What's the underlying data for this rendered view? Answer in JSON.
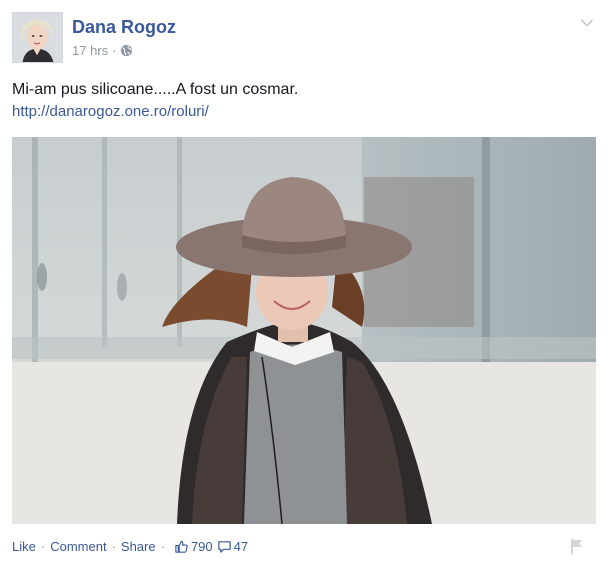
{
  "post": {
    "author_name": "Dana Rogoz",
    "timestamp": "17 hrs",
    "privacy_icon": "globe-icon",
    "menu_icon": "chevron-down-icon",
    "message": "Mi-am pus silicoane.....A fost un cosmar.",
    "link_text": "http://danarogoz.one.ro/roluri/",
    "photo_description_icon": "photo"
  },
  "actions": {
    "like_label": "Like",
    "comment_label": "Comment",
    "share_label": "Share",
    "separator": "·",
    "like_count": "790",
    "comment_count": "47",
    "like_icon": "thumbs-up-icon",
    "comment_icon": "comment-icon",
    "report_icon": "flag-icon"
  },
  "colors": {
    "link": "#3b5998",
    "muted": "#9197a3",
    "text": "#141823"
  }
}
